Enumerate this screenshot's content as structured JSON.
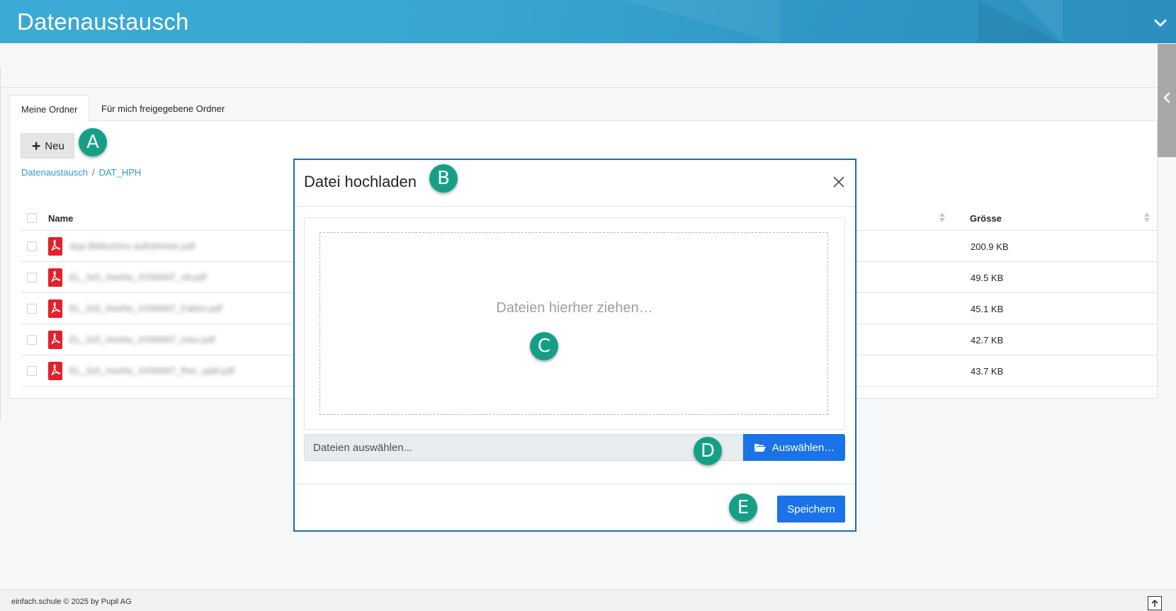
{
  "header": {
    "title": "Datenaustausch"
  },
  "tabs": [
    {
      "label": "Meine Ordner",
      "active": true
    },
    {
      "label": "Für mich freigegebene Ordner",
      "active": false
    }
  ],
  "toolbar": {
    "new_label": "Neu"
  },
  "breadcrumb": {
    "items": [
      "Datenaustausch",
      "DAT_HPH"
    ],
    "separator": "/"
  },
  "table": {
    "columns": {
      "name": "Name",
      "size": "Grösse"
    },
    "rows": [
      {
        "name": "App Bildschirm aufnehmen.pdf",
        "size": "200.9 KB",
        "icon": "pdf-icon"
      },
      {
        "name": "EL_3x5_Hoehe_XXNNNT_v8.pdf",
        "size": "49.5 KB",
        "icon": "pdf-icon"
      },
      {
        "name": "EL_3x5_Hoehe_XXNNNT_Faktor.pdf",
        "size": "45.1 KB",
        "icon": "pdf-icon"
      },
      {
        "name": "EL_3x5_Hoehe_XXNNNT_rneu.pdf",
        "size": "42.7 KB",
        "icon": "pdf-icon"
      },
      {
        "name": "EL_3x5_Hoehe_XXNNNT_fher_spld.pdf",
        "size": "43.7 KB",
        "icon": "pdf-icon"
      }
    ]
  },
  "modal": {
    "title": "Datei hochladen",
    "dropzone_text": "Dateien hierher ziehen…",
    "file_input_placeholder": "Dateien auswählen...",
    "select_label": "Auswählen…",
    "save_label": "Speichern"
  },
  "markers": [
    "A",
    "B",
    "C",
    "D",
    "E"
  ],
  "footer": {
    "text": "einfach.schule © 2025 by Pupil AG"
  },
  "colors": {
    "header": "#38a6d1",
    "primary": "#1a73e8",
    "marker": "#15a085",
    "link": "#2f9bd3",
    "pdf": "#e3202b"
  }
}
